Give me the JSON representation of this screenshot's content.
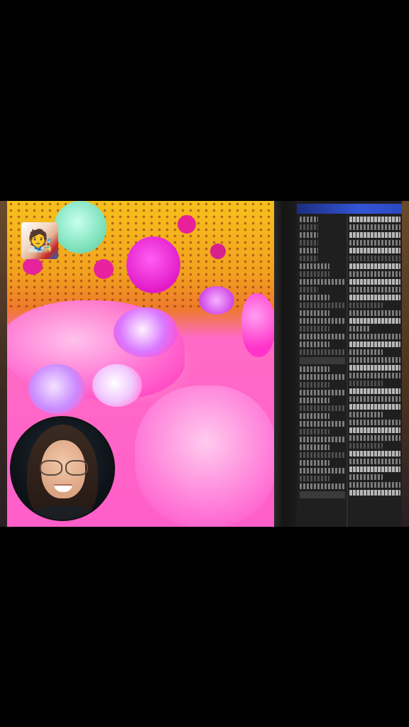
{
  "screen": {
    "canvas": {
      "palette": {
        "yellow": "#f7c11c",
        "orange": "#ee7a2a",
        "magenta": "#e21bc8",
        "pink": "#ff5ec9",
        "mint": "#7fe3bd"
      }
    },
    "sticker": {
      "icon": "cartoon-character-sticker-icon"
    },
    "avatar": {
      "icon": "webcam-presenter-avatar"
    },
    "side_panel": {
      "accent": "#3455d6"
    }
  }
}
